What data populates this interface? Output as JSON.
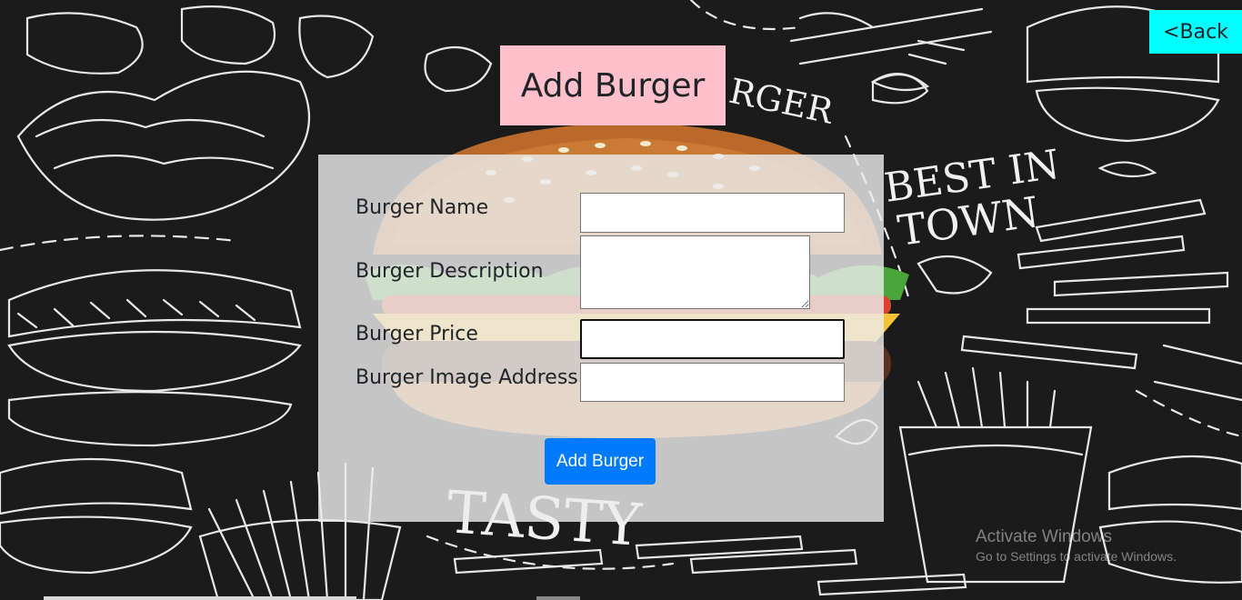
{
  "page": {
    "title": "Add Burger",
    "back_label": "<Back"
  },
  "form": {
    "fields": [
      {
        "label": "Burger Name",
        "value": "",
        "type": "text"
      },
      {
        "label": "Burger Description",
        "value": "",
        "type": "textarea"
      },
      {
        "label": "Burger Price",
        "value": "",
        "type": "text",
        "focused": true
      },
      {
        "label": "Burger Image Address",
        "value": "",
        "type": "text"
      }
    ],
    "submit_label": "Add Burger"
  },
  "background_text": {
    "best_in": "BEST IN",
    "town": "TOWN",
    "tasty": "TASTY",
    "burger": "RGER"
  },
  "watermark": {
    "title": "Activate Windows",
    "subtitle": "Go to Settings to activate Windows."
  },
  "colors": {
    "back_button": "#00ffff",
    "title_bg": "#ffc0cb",
    "submit": "#007bff",
    "background": "#1b1b1b"
  }
}
